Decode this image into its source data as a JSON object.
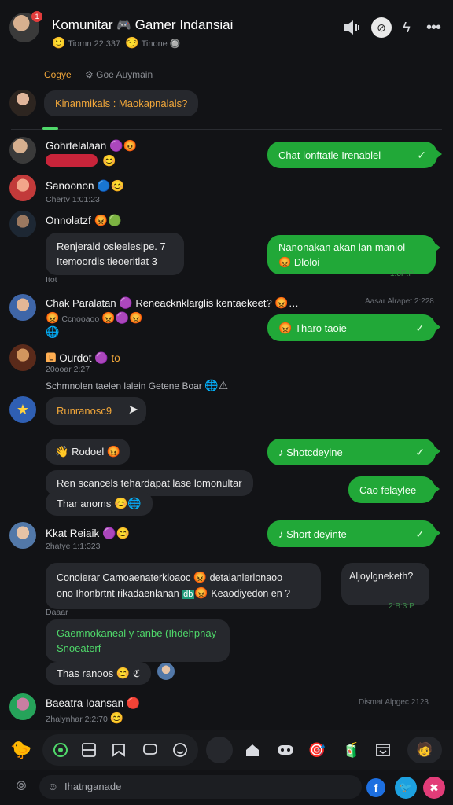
{
  "header": {
    "title": "Komunitar",
    "title_emoji": "🎮",
    "title_rest": "Gamer Indansiai",
    "subtitle_left": "Tiomn 22:337",
    "subtitle_right": "Tinone",
    "badge_count": "1"
  },
  "tabs": {
    "active": "Cogye",
    "other": "Goe Auymain"
  },
  "pinned": {
    "text": "Kinanmikals : Maokapnalals?"
  },
  "messages": [
    {
      "name": "Gohrtelalaan",
      "sub": "",
      "text": ""
    },
    {
      "name": "Sanoonon",
      "sub": "Chertv 1:01:23"
    },
    {
      "name": "Onnolatzf",
      "text_line1": "Renjerald osleelesipe.  7",
      "text_line2": "Itemoordis tieoeritlat  3",
      "foot": "Itot"
    },
    {
      "name": "Chak Paralatan",
      "text": "Reneacknklarglis kentaekeet?",
      "time": "Aasar Alrapet 2:228",
      "sub": "Ccnooaoo"
    },
    {
      "name": "Ourdot",
      "sub": "20ooar 2:27",
      "foot_text": "Schmnolen taelen lalein Getene Boar"
    },
    {
      "name": "Runranosc9"
    },
    {
      "name": "Rodoel",
      "line1": "Ren scancels tehardapat lase lomonultar",
      "line2": "Thar anoms"
    },
    {
      "name": "Kkat Reiaik",
      "sub": "2hatye 1:1:323",
      "line1": "Conoierar  Camoaenaterkloaoc",
      "line1b": "detalanlerlonaoo",
      "line2": "ono Ihonbrtnt rikadaenlanan",
      "line2b": "Keaodiyedon en ?",
      "foot": "Daaar",
      "green_line1": "Gaemnokaneal y tanbe (Ihdehpnay",
      "green_line2": "Snoeaterf",
      "last": "Thas ranoos"
    },
    {
      "name": "Baeatra Ioansan",
      "sub": "Zhalynhar 2:2:70",
      "time": "Dismat Alpgec 2123"
    }
  ],
  "outgoing": [
    {
      "text": "Chat ionftatle Irenablel"
    },
    {
      "text_line1": "Nanonakan akan lan maniol",
      "text_line2": "Dloloi",
      "time": "1:3P:P"
    },
    {
      "text": "Tharo taoie"
    },
    {
      "text": "Shotcdeyine"
    },
    {
      "text": "Cao felaylee"
    },
    {
      "text": "Short deyinte"
    },
    {
      "text": "Aljoylgneketh?",
      "time": "2:B:3:P"
    }
  ],
  "composer": {
    "placeholder": "Ihatnganade"
  },
  "colors": {
    "background": "#121316",
    "bubble_out": "#21a838",
    "bubble_in": "#26282d",
    "accent_orange": "#f0a63a",
    "accent_green": "#4fd86a"
  }
}
